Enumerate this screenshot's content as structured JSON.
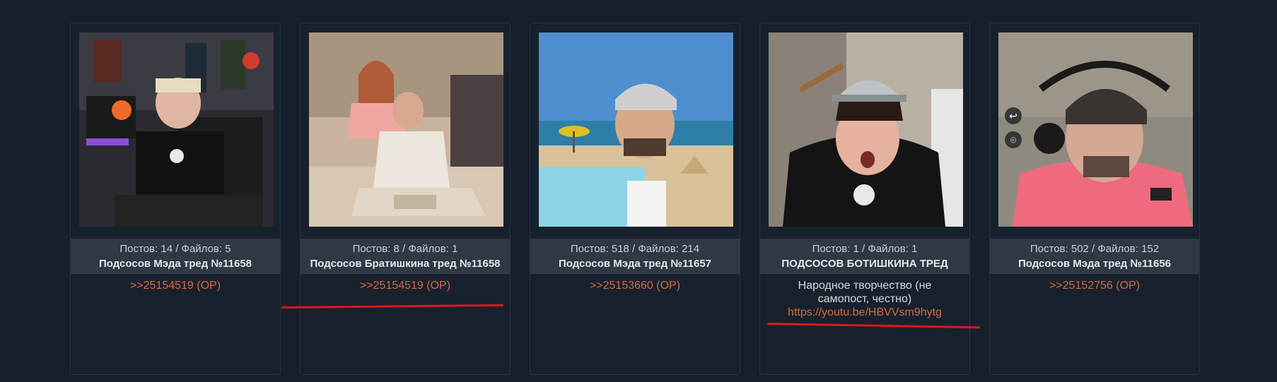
{
  "threads": [
    {
      "counts": "Постов: 14 / Файлов: 5",
      "title": "Подсосов Мэда тред №11658",
      "ref": ">>25154519 (OP)"
    },
    {
      "counts": "Постов: 8 / Файлов: 1",
      "title": "Подсосов Братишкина тред №11658",
      "ref": ">>25154519 (OP)"
    },
    {
      "counts": "Постов: 518 / Файлов: 214",
      "title": "Подсосов Мэда тред №11657",
      "ref": ">>25153660 (OP)"
    },
    {
      "counts": "Постов: 1 / Файлов: 1",
      "title": "ПОДСОСОВ БОТИШКИНА ТРЕД",
      "comment": "Народное творчество (не самопост, честно)",
      "url": "https://youtu.be/HBVVsm9hytg"
    },
    {
      "counts": "Постов: 502 / Файлов: 152",
      "title": "Подсосов Мэда тред №11656",
      "ref": ">>25152756 (OP)"
    }
  ],
  "colors": {
    "background": "#16202c",
    "card": "#17212d",
    "stats_bar": "#2e3944",
    "link": "#d9683a",
    "annotation": "#e0161a"
  },
  "icons": {
    "thumb5_top": "back-arrow-icon",
    "thumb5_bottom": "location-pin-icon"
  }
}
